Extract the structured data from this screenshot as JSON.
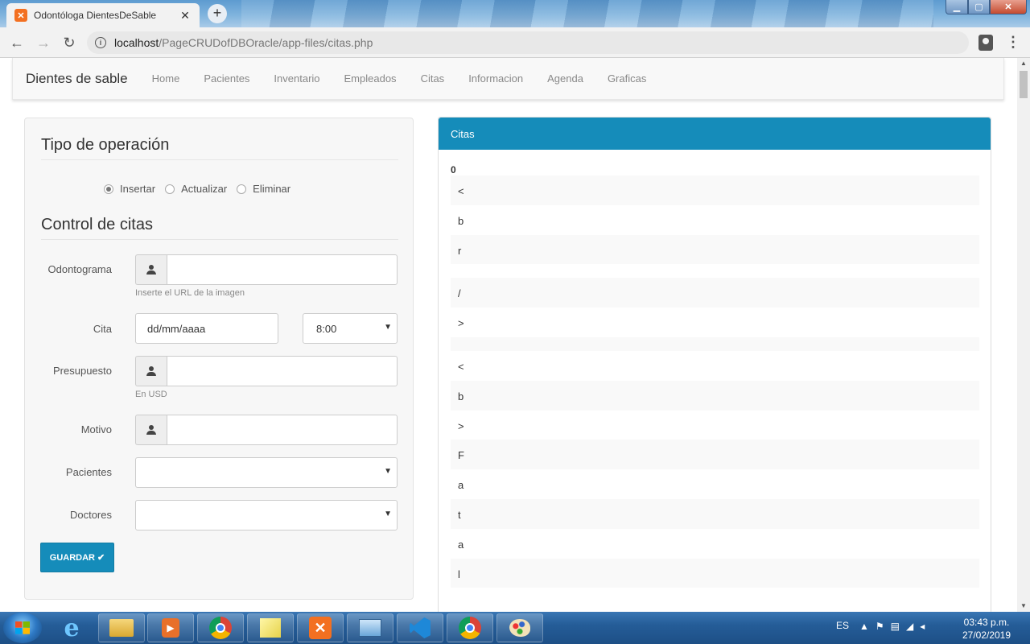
{
  "browser": {
    "tab_title": "Odontóloga DientesDeSable",
    "new_tab": "+",
    "tab_close": "✕",
    "url_host": "localhost",
    "url_path": "/PageCRUDofDBOracle/app-files/citas.php"
  },
  "navbar": {
    "brand": "Dientes de sable",
    "links": [
      "Home",
      "Pacientes",
      "Inventario",
      "Empleados",
      "Citas",
      "Informacion",
      "Agenda",
      "Graficas"
    ]
  },
  "form": {
    "section_operation": "Tipo de operación",
    "operations": [
      "Insertar",
      "Actualizar",
      "Eliminar"
    ],
    "selected_operation": "Insertar",
    "section_control": "Control de citas",
    "odontograma_label": "Odontograma",
    "odontograma_help": "Inserte el URL de la imagen",
    "cita_label": "Cita",
    "cita_date_placeholder": "dd/mm/aaaa",
    "cita_time": "8:00",
    "presupuesto_label": "Presupuesto",
    "presupuesto_help": "En USD",
    "motivo_label": "Motivo",
    "pacientes_label": "Pacientes",
    "doctores_label": "Doctores",
    "save_label": "GUARDAR"
  },
  "citas_panel": {
    "heading": "Citas",
    "count": "0",
    "rows": [
      "<",
      "b",
      "r",
      "/",
      ">",
      "<",
      "b",
      ">",
      "F",
      "a",
      "t",
      "a",
      "l"
    ]
  },
  "taskbar": {
    "language": "ES",
    "time": "03:43 p.m.",
    "date": "27/02/2019"
  },
  "colors": {
    "accent": "#158cba",
    "taskbar": "#255d98"
  }
}
